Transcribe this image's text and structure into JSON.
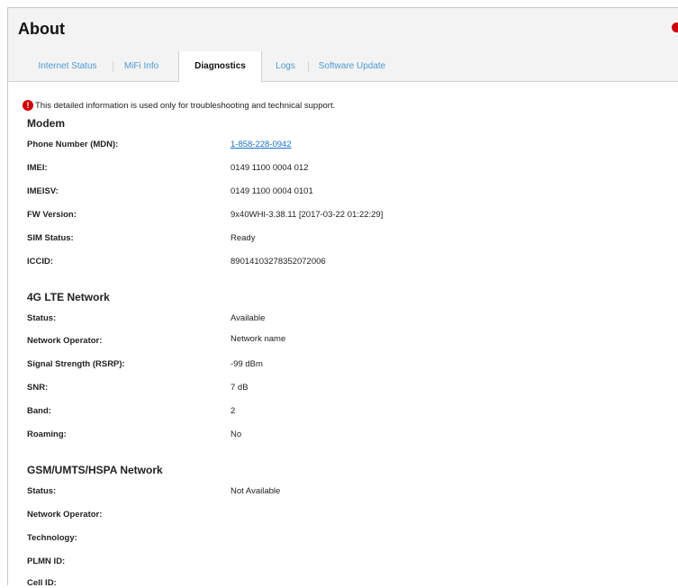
{
  "header": {
    "title": "About"
  },
  "tabs": [
    {
      "label": "Internet Status"
    },
    {
      "label": "MiFi Info"
    },
    {
      "label": "Diagnostics"
    },
    {
      "label": "Logs"
    },
    {
      "label": "Software Update"
    }
  ],
  "active_tab": "Diagnostics",
  "notice": {
    "icon": "alert-icon",
    "glyph": "!",
    "text": "This detailed information is used only for troubleshooting and technical support."
  },
  "modem": {
    "title": "Modem",
    "rows": [
      {
        "label": "Phone Number (MDN):",
        "value": "1-858-228-0942"
      },
      {
        "label": "IMEI:",
        "value": "0149 1100 0004 012"
      },
      {
        "label": "IMEISV:",
        "value": "0149 1100 0004 0101"
      },
      {
        "label": "FW Version:",
        "value": "9x40WHI-3.38.11 [2017-03-22 01:22:29]"
      },
      {
        "label": "SIM Status:",
        "value": "Ready"
      },
      {
        "label": "ICCID:",
        "value": "89014103278352072006"
      }
    ]
  },
  "lte": {
    "title": "4G LTE Network",
    "rows": [
      {
        "label": "Status:",
        "value": "Available"
      },
      {
        "label": "Network Operator:",
        "value": "Network name"
      },
      {
        "label": "Signal Strength (RSRP):",
        "value": "-99 dBm"
      },
      {
        "label": "SNR:",
        "value": "7 dB"
      },
      {
        "label": "Band:",
        "value": "2"
      },
      {
        "label": "Roaming:",
        "value": "No"
      }
    ]
  },
  "gsm": {
    "title": "GSM/UMTS/HSPA Network",
    "rows": [
      {
        "label": "Status:",
        "value": "Not Available"
      },
      {
        "label": "Network Operator:",
        "value": ""
      },
      {
        "label": "Technology:",
        "value": ""
      },
      {
        "label": "PLMN ID:",
        "value": ""
      },
      {
        "label": "Cell ID:",
        "value": ""
      }
    ]
  },
  "colors": {
    "accent_red": "#cd040b",
    "tab_link": "#4d9ad6",
    "link": "#1a6fc9",
    "header_bg": "#f3f3f3"
  }
}
